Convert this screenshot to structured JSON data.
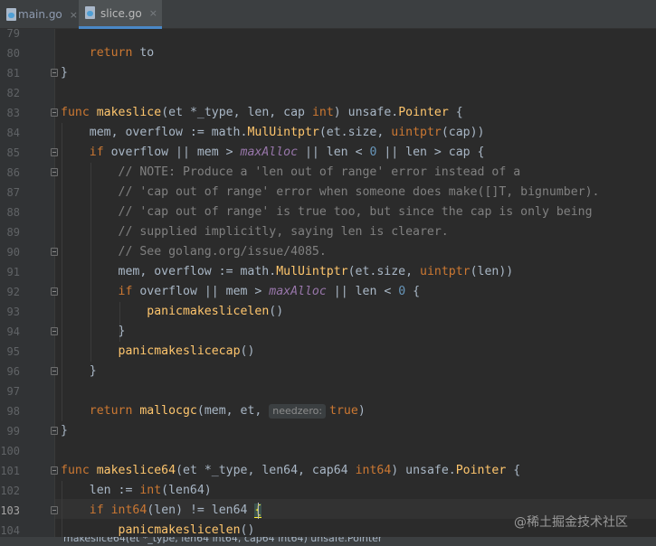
{
  "tabs": [
    {
      "label": "main.go",
      "close": "×",
      "active": false
    },
    {
      "label": "slice.go",
      "close": "×",
      "active": true
    }
  ],
  "editor": {
    "line_numbers": [
      "79",
      "80",
      "81",
      "82",
      "83",
      "84",
      "85",
      "86",
      "87",
      "88",
      "89",
      "90",
      "91",
      "92",
      "93",
      "94",
      "95",
      "96",
      "97",
      "98",
      "99",
      "100",
      "101",
      "102",
      "103",
      "104"
    ],
    "current_line": "103",
    "inlay_hint": "needzero:"
  },
  "status": {
    "breadcrumb": "makeslice64(et *_type, len64 int64, cap64 int64) unsafe.Pointer"
  },
  "watermark": "@稀土掘金技术社区"
}
